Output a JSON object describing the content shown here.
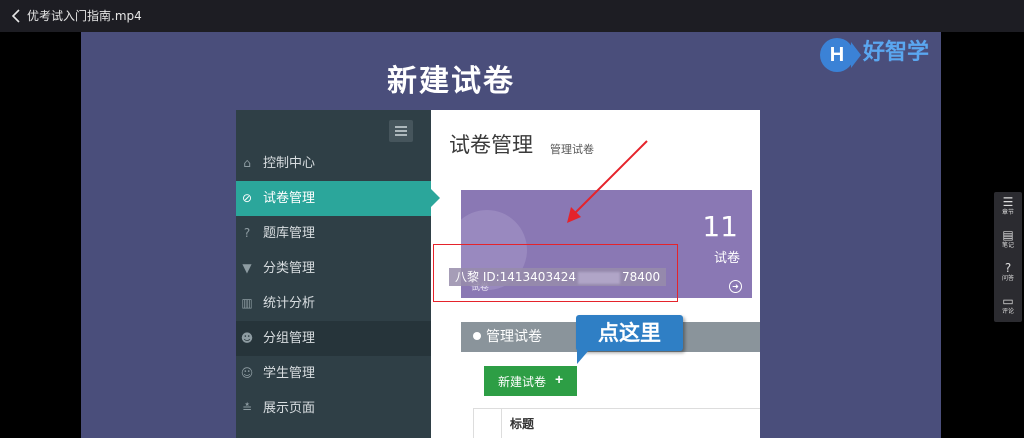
{
  "window": {
    "title": "优考试入门指南.mp4"
  },
  "slide": {
    "title": "新建试卷",
    "logo": {
      "letter": "H",
      "text": "好智学"
    },
    "callout": "点这里"
  },
  "app": {
    "sidebar": {
      "items": [
        {
          "icon": "home-icon",
          "label": "控制中心"
        },
        {
          "icon": "check-circle-icon",
          "label": "试卷管理",
          "active": true
        },
        {
          "icon": "question-circle-icon",
          "label": "题库管理"
        },
        {
          "icon": "filter-icon",
          "label": "分类管理"
        },
        {
          "icon": "bar-chart-icon",
          "label": "统计分析"
        },
        {
          "icon": "group-icon",
          "label": "分组管理"
        },
        {
          "icon": "user-icon",
          "label": "学生管理"
        },
        {
          "icon": "display-icon",
          "label": "展示页面"
        }
      ]
    },
    "main": {
      "title": "试卷管理",
      "subtitle": "管理试卷",
      "stat": {
        "value": "11",
        "label": "试卷",
        "small_label": "试卷"
      },
      "id_overlay": {
        "prefix": "八黎 ID:1413403424",
        "suffix": "78400"
      },
      "manage_section": "管理试卷",
      "new_button": "新建试卷",
      "table": {
        "headers": [
          "标题"
        ]
      }
    }
  },
  "player_side": {
    "items": [
      {
        "icon": "list-icon",
        "label": "章节"
      },
      {
        "icon": "note-icon",
        "label": "笔记"
      },
      {
        "icon": "question-icon",
        "label": "问答"
      },
      {
        "icon": "comment-icon",
        "label": "评论"
      }
    ]
  },
  "colors": {
    "slide_bg": "#4a4e7b",
    "sidebar_bg": "#2f3f46",
    "active_teal": "#2ba69b",
    "stat_purple": "#8a78b4",
    "button_green": "#2d9e45",
    "callout_blue": "#2f7fc5",
    "annotation_red": "#e5232b"
  }
}
